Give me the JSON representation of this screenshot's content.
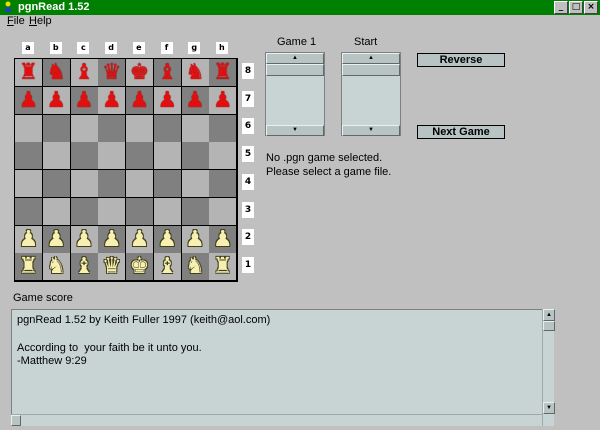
{
  "window": {
    "title": "pgnRead 1.52",
    "controls": {
      "minimize": "_",
      "maximize": "□",
      "close": "×"
    }
  },
  "menu": [
    "File",
    "Help"
  ],
  "board": {
    "files": [
      "a",
      "b",
      "c",
      "d",
      "e",
      "f",
      "g",
      "h"
    ],
    "ranks": [
      "8",
      "7",
      "6",
      "5",
      "4",
      "3",
      "2",
      "1"
    ],
    "position": [
      [
        "♜",
        "♞",
        "♝",
        "♛",
        "♚",
        "♝",
        "♞",
        "♜"
      ],
      [
        "♟",
        "♟",
        "♟",
        "♟",
        "♟",
        "♟",
        "♟",
        "♟"
      ],
      [
        "",
        "",
        "",
        "",
        "",
        "",
        "",
        ""
      ],
      [
        "",
        "",
        "",
        "",
        "",
        "",
        "",
        ""
      ],
      [
        "",
        "",
        "",
        "",
        "",
        "",
        "",
        ""
      ],
      [
        "",
        "",
        "",
        "",
        "",
        "",
        "",
        ""
      ],
      [
        "♟",
        "♟",
        "♟",
        "♟",
        "♟",
        "♟",
        "♟",
        "♟"
      ],
      [
        "♜",
        "♞",
        "♝",
        "♛",
        "♚",
        "♝",
        "♞",
        "♜"
      ]
    ],
    "colors": {
      "light": "#b4b4b4",
      "dark": "#808080",
      "red_piece": "#e01010",
      "white_piece": "#f8f0b0"
    }
  },
  "panel": {
    "game_heading": "Game 1",
    "start_heading": "Start",
    "reverse_label": "Reverse",
    "next_game_label": "Next Game"
  },
  "messages": [
    "No .pgn game selected.",
    "Please select a game file."
  ],
  "score": {
    "label": "Game score",
    "lines": [
      "pgnRead 1.52 by Keith Fuller 1997 (keith@aol.com)",
      "",
      "According to  your faith be it unto you.",
      "-Matthew 9:29"
    ]
  }
}
